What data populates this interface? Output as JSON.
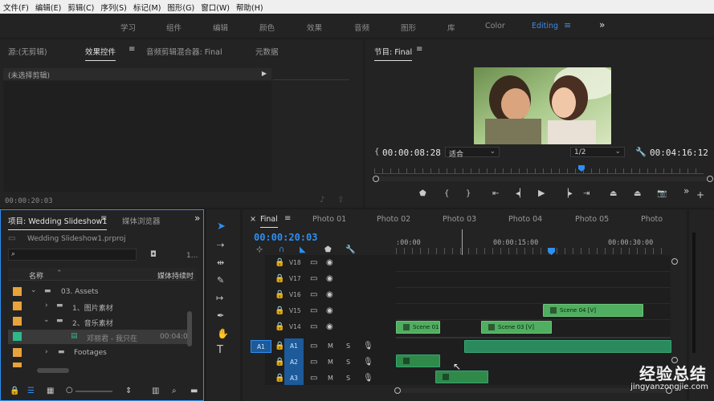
{
  "menu": [
    "文件(F)",
    "编辑(E)",
    "剪辑(C)",
    "序列(S)",
    "标记(M)",
    "图形(G)",
    "窗口(W)",
    "帮助(H)"
  ],
  "workspaces": [
    "学习",
    "组件",
    "编辑",
    "颜色",
    "效果",
    "音频",
    "图形",
    "库",
    "Color",
    "Editing"
  ],
  "source_panel": {
    "tabs": [
      "源:(无剪辑)",
      "效果控件",
      "音频剪辑混合器: Final",
      "元数据"
    ],
    "no_clip": "(未选择剪辑)",
    "timecode": "00:00:20:03"
  },
  "program_panel": {
    "title": "节目: Final",
    "timecode": "00:00:08:28",
    "fit": "适合",
    "resolution": "1/2",
    "duration": "00:04:16:12"
  },
  "project_panel": {
    "tabs": [
      "项目: Wedding Slideshow1",
      "媒体浏览器"
    ],
    "file": "Wedding Slideshow1.prproj",
    "count": "1...",
    "col_name": "名称",
    "col_duration": "媒体持续时",
    "tree": [
      {
        "label": "03. Assets",
        "color": "#e8a33a"
      },
      {
        "label": "1、图片素材",
        "color": "#e8a33a"
      },
      {
        "label": "2、音乐素材",
        "color": "#e8a33a"
      },
      {
        "label": "邓丽君 - 我只在",
        "duration": "00:04:0",
        "color": "#2eb88a"
      },
      {
        "label": "Footages",
        "color": "#e8a33a"
      }
    ]
  },
  "timeline": {
    "tabs": [
      "Final",
      "Photo 01",
      "Photo 02",
      "Photo 03",
      "Photo 04",
      "Photo 05",
      "Photo"
    ],
    "timecode": "00:00:20:03",
    "ruler": [
      ":00:00",
      "00:00:15:00",
      "00:00:30:00"
    ],
    "tracks": [
      {
        "id": "V18"
      },
      {
        "id": "V17"
      },
      {
        "id": "V16"
      },
      {
        "id": "V15"
      },
      {
        "id": "V14"
      },
      {
        "id": "A1"
      },
      {
        "id": "A2"
      },
      {
        "id": "A3"
      }
    ],
    "source_patch": "A1",
    "clips": [
      "Scene 04 [V]",
      "Scene 01",
      "Scene 03 [V]"
    ],
    "mute_label": "M",
    "solo_label": "S"
  },
  "watermark": {
    "main": "经验总结",
    "sub": "jingyanzongjie.com"
  }
}
